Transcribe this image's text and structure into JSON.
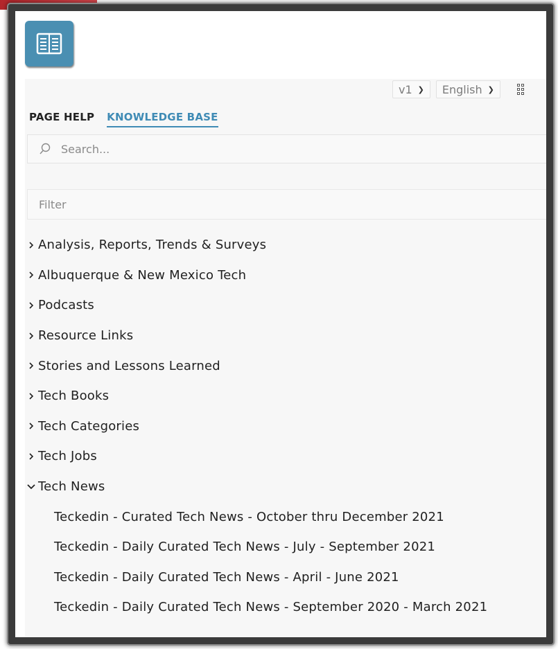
{
  "tabs": {
    "page_help": "PAGE HELP",
    "knowledge_base": "KNOWLEDGE BASE"
  },
  "controls": {
    "version": "v1",
    "language": "English"
  },
  "search": {
    "placeholder": "Search..."
  },
  "filter": {
    "placeholder": "Filter"
  },
  "tree": {
    "items": [
      {
        "label": "Analysis, Reports, Trends & Surveys"
      },
      {
        "label": "Albuquerque & New Mexico Tech"
      },
      {
        "label": "Podcasts"
      },
      {
        "label": "Resource Links"
      },
      {
        "label": "Stories and Lessons Learned"
      },
      {
        "label": "Tech Books"
      },
      {
        "label": "Tech Categories"
      },
      {
        "label": "Tech Jobs"
      },
      {
        "label": "Tech News"
      }
    ],
    "tech_news_children": [
      {
        "label": "Teckedin - Curated Tech News - October thru December 2021"
      },
      {
        "label": "Teckedin - Daily Curated Tech News - July - September 2021"
      },
      {
        "label": "Teckedin - Daily Curated Tech News - April - June 2021"
      },
      {
        "label": "Teckedin - Daily Curated Tech News - September 2020 - March 2021"
      }
    ]
  },
  "colors": {
    "accent": "#3f8bb5",
    "logo_bg": "#4a8fb2",
    "panel_bg": "#f7f7f7"
  }
}
